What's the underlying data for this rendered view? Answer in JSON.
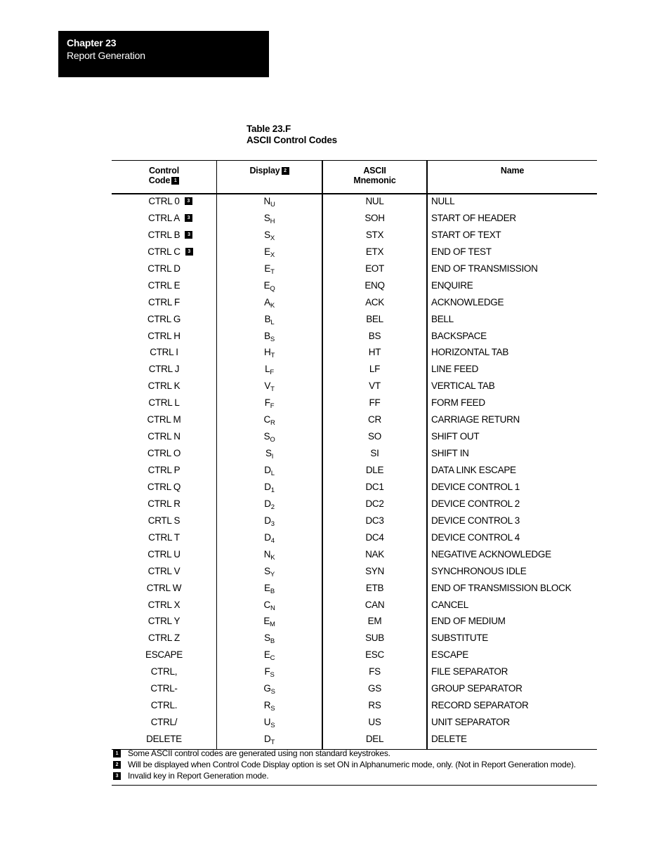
{
  "header": {
    "chapter": "Chapter 23",
    "title": "Report Generation"
  },
  "table": {
    "caption_line1": "Table 23.F",
    "caption_line2": "ASCII Control Codes",
    "columns": [
      {
        "label_line1": "Control",
        "label_line2": "Code",
        "footnote": "1"
      },
      {
        "label_line1": "Display",
        "label_line2": "",
        "footnote": "2"
      },
      {
        "label_line1": "ASCII",
        "label_line2": "Mnemonic",
        "footnote": ""
      },
      {
        "label_line1": "Name",
        "label_line2": "",
        "footnote": ""
      }
    ],
    "rows": [
      {
        "code": "CTRL 0",
        "note": "3",
        "disp": "N",
        "sub": "U",
        "mnemonic": "NUL",
        "name": "NULL"
      },
      {
        "code": "CTRL A",
        "note": "3",
        "disp": "S",
        "sub": "H",
        "mnemonic": "SOH",
        "name": "START OF HEADER"
      },
      {
        "code": "CTRL B",
        "note": "3",
        "disp": "S",
        "sub": "X",
        "mnemonic": "STX",
        "name": "START OF TEXT"
      },
      {
        "code": "CTRL C",
        "note": "3",
        "disp": "E",
        "sub": "X",
        "mnemonic": "ETX",
        "name": "END OF TEST"
      },
      {
        "code": "CTRL D",
        "note": "",
        "disp": "E",
        "sub": "T",
        "mnemonic": "EOT",
        "name": "END OF TRANSMISSION"
      },
      {
        "code": "CTRL E",
        "note": "",
        "disp": "E",
        "sub": "Q",
        "mnemonic": "ENQ",
        "name": "ENQUIRE"
      },
      {
        "code": "CTRL F",
        "note": "",
        "disp": "A",
        "sub": "K",
        "mnemonic": "ACK",
        "name": "ACKNOWLEDGE"
      },
      {
        "code": "CTRL G",
        "note": "",
        "disp": "B",
        "sub": "L",
        "mnemonic": "BEL",
        "name": "BELL"
      },
      {
        "code": "CTRL H",
        "note": "",
        "disp": "B",
        "sub": "S",
        "mnemonic": "BS",
        "name": "BACKSPACE"
      },
      {
        "code": "CTRL I",
        "note": "",
        "disp": "H",
        "sub": "T",
        "mnemonic": "HT",
        "name": "HORIZONTAL TAB"
      },
      {
        "code": "CTRL J",
        "note": "",
        "disp": "L",
        "sub": "F",
        "mnemonic": "LF",
        "name": "LINE FEED"
      },
      {
        "code": "CTRL K",
        "note": "",
        "disp": "V",
        "sub": "T",
        "mnemonic": "VT",
        "name": "VERTICAL TAB"
      },
      {
        "code": "CTRL L",
        "note": "",
        "disp": "F",
        "sub": "F",
        "mnemonic": "FF",
        "name": "FORM FEED"
      },
      {
        "code": "CTRL M",
        "note": "",
        "disp": "C",
        "sub": "R",
        "mnemonic": "CR",
        "name": "CARRIAGE RETURN"
      },
      {
        "code": "CTRL N",
        "note": "",
        "disp": "S",
        "sub": "O",
        "mnemonic": "SO",
        "name": "SHIFT OUT"
      },
      {
        "code": "CTRL O",
        "note": "",
        "disp": "S",
        "sub": "I",
        "mnemonic": "SI",
        "name": "SHIFT IN"
      },
      {
        "code": "CTRL P",
        "note": "",
        "disp": "D",
        "sub": "L",
        "mnemonic": "DLE",
        "name": "DATA LINK ESCAPE"
      },
      {
        "code": "CTRL Q",
        "note": "",
        "disp": "D",
        "sub": "1",
        "mnemonic": "DC1",
        "name": "DEVICE CONTROL 1"
      },
      {
        "code": "CTRL R",
        "note": "",
        "disp": "D",
        "sub": "2",
        "mnemonic": "DC2",
        "name": "DEVICE CONTROL 2"
      },
      {
        "code": "CRTL S",
        "note": "",
        "disp": "D",
        "sub": "3",
        "mnemonic": "DC3",
        "name": "DEVICE CONTROL 3"
      },
      {
        "code": "CTRL T",
        "note": "",
        "disp": "D",
        "sub": "4",
        "mnemonic": "DC4",
        "name": "DEVICE CONTROL 4"
      },
      {
        "code": "CTRL U",
        "note": "",
        "disp": "N",
        "sub": "K",
        "mnemonic": "NAK",
        "name": "NEGATIVE ACKNOWLEDGE"
      },
      {
        "code": "CTRL V",
        "note": "",
        "disp": "S",
        "sub": "Y",
        "mnemonic": "SYN",
        "name": "SYNCHRONOUS IDLE"
      },
      {
        "code": "CTRL W",
        "note": "",
        "disp": "E",
        "sub": "B",
        "mnemonic": "ETB",
        "name": "END OF TRANSMISSION BLOCK"
      },
      {
        "code": "CTRL X",
        "note": "",
        "disp": "C",
        "sub": "N",
        "mnemonic": "CAN",
        "name": "CANCEL"
      },
      {
        "code": "CTRL Y",
        "note": "",
        "disp": "E",
        "sub": "M",
        "mnemonic": "EM",
        "name": "END OF MEDIUM"
      },
      {
        "code": "CTRL Z",
        "note": "",
        "disp": "S",
        "sub": "B",
        "mnemonic": "SUB",
        "name": "SUBSTITUTE"
      },
      {
        "code": "ESCAPE",
        "note": "",
        "disp": "E",
        "sub": "C",
        "mnemonic": "ESC",
        "name": "ESCAPE"
      },
      {
        "code": "CTRL,",
        "note": "",
        "disp": "F",
        "sub": "S",
        "mnemonic": "FS",
        "name": "FILE SEPARATOR"
      },
      {
        "code": "CTRL-",
        "note": "",
        "disp": "G",
        "sub": "S",
        "mnemonic": "GS",
        "name": "GROUP SEPARATOR"
      },
      {
        "code": "CTRL.",
        "note": "",
        "disp": "R",
        "sub": "S",
        "mnemonic": "RS",
        "name": "RECORD SEPARATOR"
      },
      {
        "code": "CTRL/",
        "note": "",
        "disp": "U",
        "sub": "S",
        "mnemonic": "US",
        "name": "UNIT SEPARATOR"
      },
      {
        "code": "DELETE",
        "note": "",
        "disp": "D",
        "sub": "T",
        "mnemonic": "DEL",
        "name": "DELETE"
      }
    ]
  },
  "footnotes": [
    {
      "num": "1",
      "text": "Some ASCII control codes are generated using non standard keystrokes."
    },
    {
      "num": "2",
      "text": "Will be displayed when Control Code Display option is set ON in Alphanumeric mode, only.  (Not in Report Generation mode)."
    },
    {
      "num": "3",
      "text": "Invalid key in Report Generation mode."
    }
  ]
}
